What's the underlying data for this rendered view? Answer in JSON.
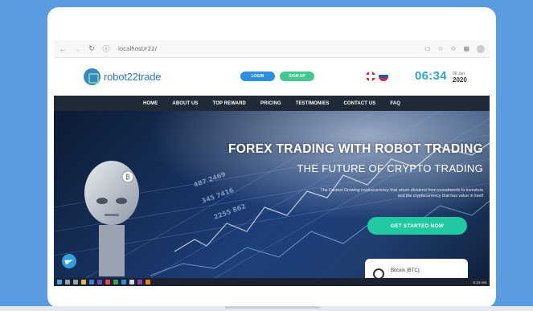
{
  "browser": {
    "url": "localhost/r22/",
    "nav_back": "←",
    "nav_forward": "→",
    "nav_reload": "↻",
    "info_icon": "ⓘ"
  },
  "header": {
    "logo_text": "robot22trade",
    "login_label": "LOGIN",
    "signup_label": "SIGN UP",
    "time": "06:34",
    "date_day": "06 Jun",
    "date_year": "2020"
  },
  "nav": {
    "items": [
      "HOME",
      "ABOUT US",
      "TOP REWARD",
      "PRICING",
      "TESTIMONIES",
      "CONTACT US",
      "FAQ"
    ]
  },
  "hero": {
    "title": "FOREX TRADING WITH ROBOT TRADING",
    "subtitle": "THE FUTURE OF CRYPTO TRADING",
    "desc_line1": "The Fastest Growing cryptocurrency that return dividend from investments to investors",
    "desc_line2": "and the cryptocurrency that has value in itself",
    "cta_label": "GET STARTED NOW",
    "coin_label": "Bitcoin (BTC):"
  },
  "taskbar": {
    "time": "6:34 AM"
  },
  "colors": {
    "page_bg": "#5b9ce0",
    "login": "#2d8fe0",
    "signup": "#43c98e",
    "cta": "#21c9a3",
    "nav_bg": "#1f2a36",
    "clock": "#2fa5cf"
  }
}
